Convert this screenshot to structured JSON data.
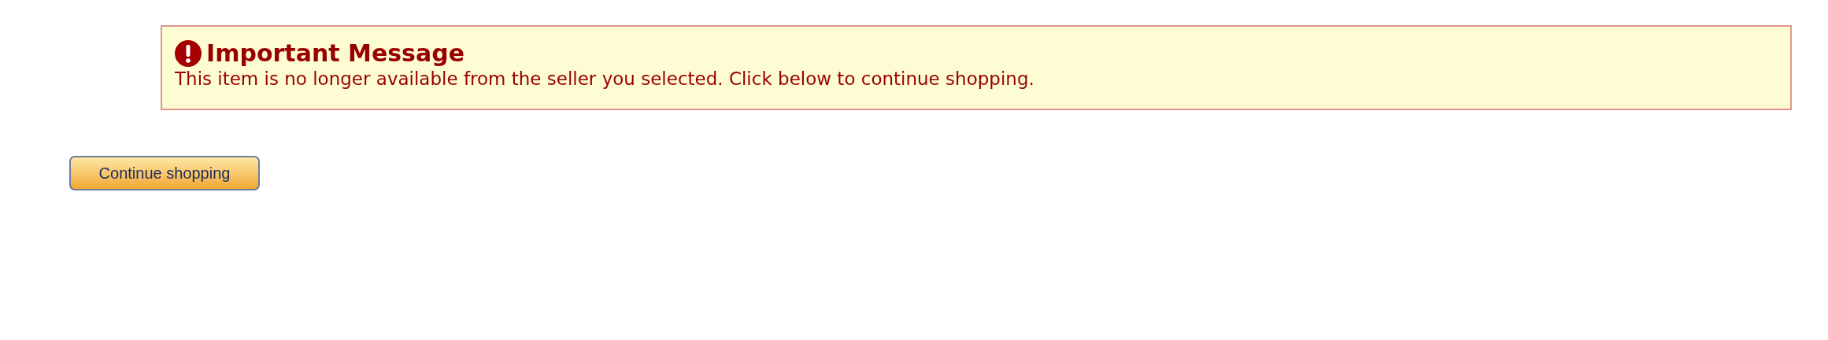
{
  "alert": {
    "title": "Important Message",
    "message": "This item is no longer available from the seller you selected. Click below to continue shopping."
  },
  "button": {
    "label": "Continue shopping"
  }
}
